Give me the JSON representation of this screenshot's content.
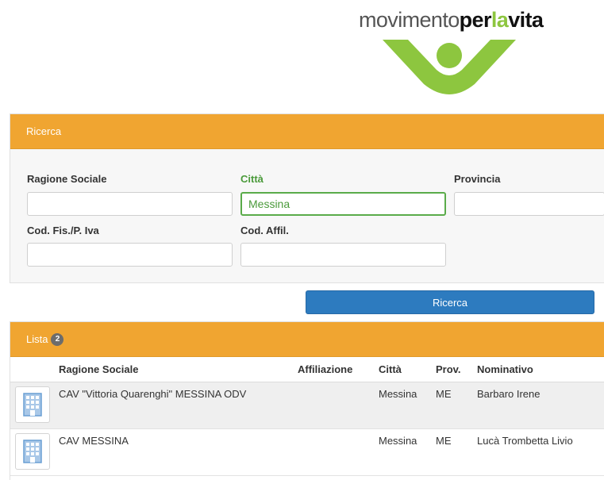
{
  "logo": {
    "text_regular": "movimento",
    "text_bold": "per",
    "text_green": "la",
    "text_bold2": "vita"
  },
  "search": {
    "header": "Ricerca",
    "fields": [
      {
        "label": "Ragione Sociale",
        "value": "",
        "placeholder": ""
      },
      {
        "label": "Città",
        "value": "Messina",
        "placeholder": ""
      },
      {
        "label": "Provincia",
        "value": "",
        "placeholder": ""
      },
      {
        "label": "Cod. Fis./P. Iva",
        "value": "",
        "placeholder": ""
      },
      {
        "label": "Cod. Affil.",
        "value": "",
        "placeholder": ""
      }
    ],
    "button_label": "Ricerca"
  },
  "list": {
    "header": "Lista",
    "count": "2",
    "columns": [
      "Ragione Sociale",
      "Affiliazione",
      "Città",
      "Prov.",
      "Nominativo"
    ],
    "rows": [
      {
        "icon": "building-icon",
        "ragione_sociale": "CAV \"Vittoria Quarenghi\" MESSINA ODV",
        "affiliazione": "",
        "citta": "Messina",
        "prov": "ME",
        "nominativo": "Barbaro Irene"
      },
      {
        "icon": "building-icon",
        "ragione_sociale": "CAV MESSINA",
        "affiliazione": "",
        "citta": "Messina",
        "prov": "ME",
        "nominativo": "Lucà Trombetta Livio"
      }
    ]
  },
  "colors": {
    "header_orange": "#f0a531",
    "button_blue": "#2d7bbf",
    "active_green": "#5aab4a",
    "logo_green": "#8dc63f"
  }
}
